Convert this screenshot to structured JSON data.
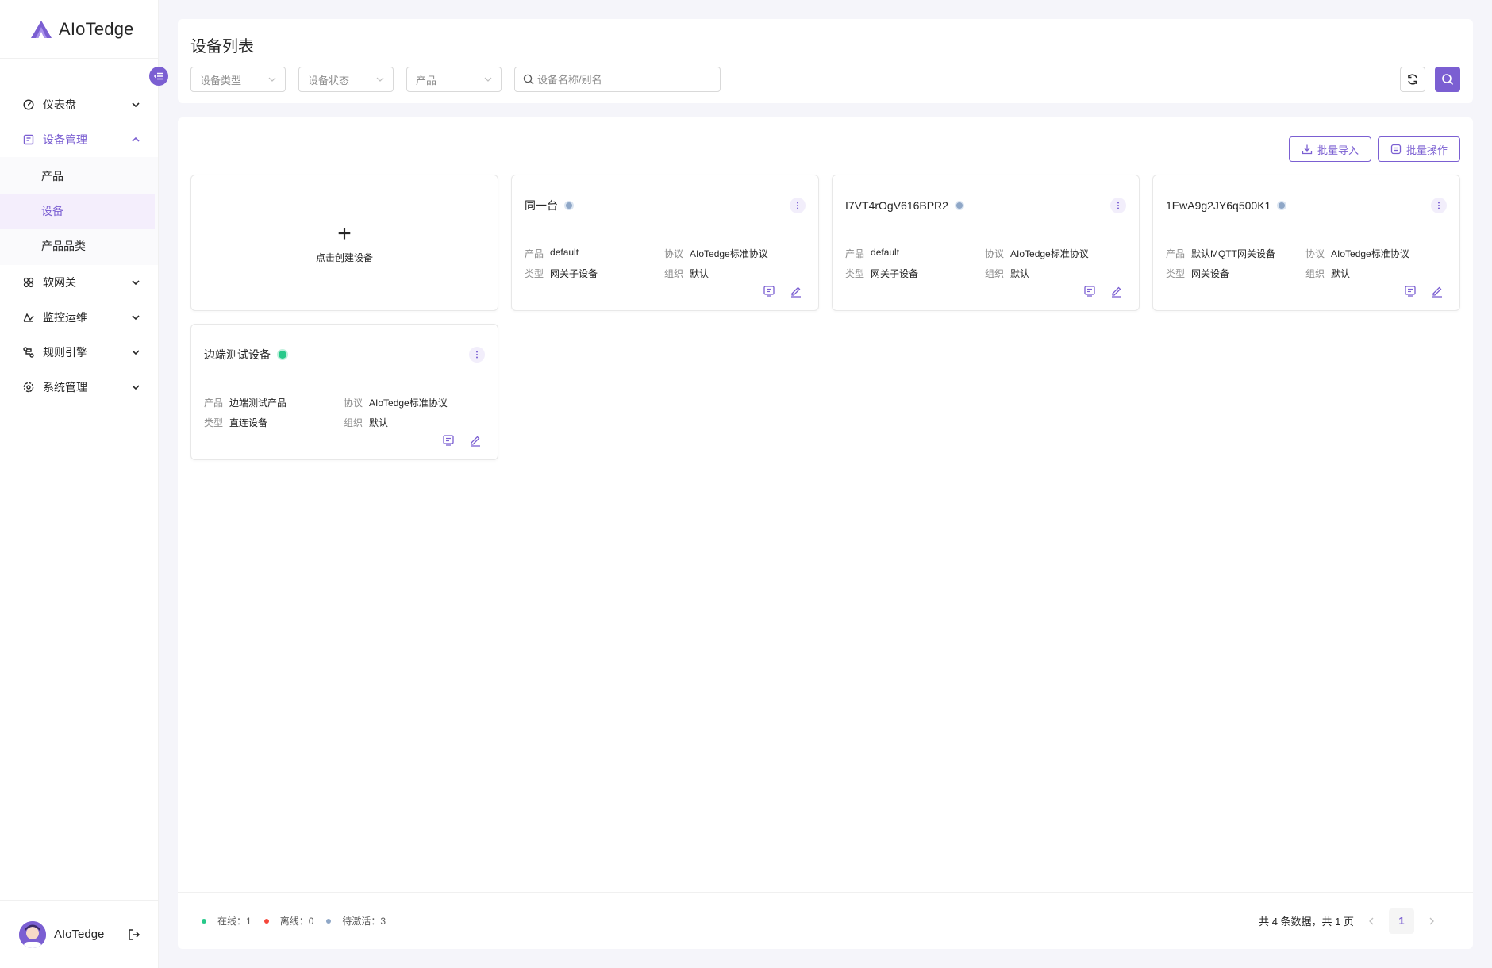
{
  "app": {
    "name": "AIoTedge"
  },
  "sidebar": {
    "items": [
      {
        "label": "仪表盘",
        "icon": "dashboard-icon"
      },
      {
        "label": "设备管理",
        "icon": "device-manage-icon",
        "expanded": true,
        "children": [
          {
            "label": "产品"
          },
          {
            "label": "设备",
            "selected": true
          },
          {
            "label": "产品品类"
          }
        ]
      },
      {
        "label": "软网关",
        "icon": "gateway-icon"
      },
      {
        "label": "监控运维",
        "icon": "monitor-icon"
      },
      {
        "label": "规则引擎",
        "icon": "rule-engine-icon"
      },
      {
        "label": "系统管理",
        "icon": "settings-icon"
      }
    ],
    "user": {
      "name": "AIoTedge"
    }
  },
  "header": {
    "title": "设备列表",
    "filters": {
      "device_type": "设备类型",
      "device_status": "设备状态",
      "product": "产品"
    },
    "search": {
      "placeholder": "设备名称/别名",
      "value": ""
    }
  },
  "toolbar": {
    "batch_import": "批量导入",
    "batch_operation": "批量操作"
  },
  "create_card": {
    "label": "点击创建设备"
  },
  "field_labels": {
    "product": "产品",
    "protocol": "协议",
    "type": "类型",
    "org": "组织"
  },
  "devices": [
    {
      "name": "同一台",
      "status": "inactive",
      "product": "default",
      "protocol": "AIoTedge标准协议",
      "type": "网关子设备",
      "org": "默认"
    },
    {
      "name": "I7VT4rOgV616BPR2",
      "status": "inactive",
      "product": "default",
      "protocol": "AIoTedge标准协议",
      "type": "网关子设备",
      "org": "默认"
    },
    {
      "name": "1EwA9g2JY6q500K1",
      "status": "inactive",
      "product": "默认MQTT网关设备",
      "protocol": "AIoTedge标准协议",
      "type": "网关设备",
      "org": "默认"
    },
    {
      "name": "边端测试设备",
      "status": "online",
      "product": "边端测试产品",
      "protocol": "AIoTedge标准协议",
      "type": "直连设备",
      "org": "默认"
    }
  ],
  "footer": {
    "online": "在线：1",
    "offline": "离线：0",
    "pending": "待激活：3",
    "summary": "共 4 条数据，共 1 页",
    "current_page": "1"
  },
  "colors": {
    "accent": "#7b5fd2",
    "online": "#28c98a",
    "offline": "#f5473b",
    "inactive": "#8fa7c7"
  }
}
